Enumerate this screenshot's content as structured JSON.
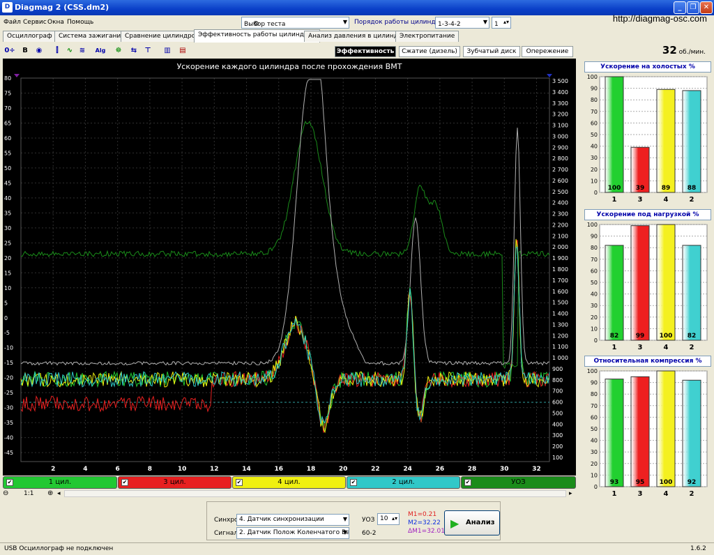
{
  "window": {
    "title": "Diagmag 2 (CSS.dm2)",
    "url": "http://diagmag-osc.com"
  },
  "menu": [
    "Файл",
    "Сервис",
    "Окна",
    "Помощь"
  ],
  "test_select": {
    "label": "Выбор теста"
  },
  "cyl_order": {
    "label": "Порядок работы цилиндров",
    "value": "1-3-4-2",
    "num": "1"
  },
  "tabs": [
    "Осциллограф",
    "Система зажигания",
    "Сравнение цилиндров",
    "Эффективность работы цилиндров",
    "Анализ давления в цилиндре",
    "Электропитание"
  ],
  "subtabs": [
    "Эффективность",
    "Сжатие (дизель)",
    "Зубчатый диск",
    "Опережение"
  ],
  "rpm": {
    "value": "32",
    "unit": "об./мин."
  },
  "chart": {
    "title": "Ускорение каждого цилиндра после прохождения ВМТ",
    "y_left": [
      "80",
      "75",
      "70",
      "65",
      "60",
      "55",
      "50",
      "45",
      "40",
      "35",
      "30",
      "25",
      "20",
      "15",
      "10",
      "5",
      "0",
      "-5",
      "-10",
      "-15",
      "-20",
      "-25",
      "-30",
      "-35",
      "-40",
      "-45"
    ],
    "y_right": [
      "3 500",
      "3 400",
      "3 300",
      "3 200",
      "3 100",
      "3 000",
      "2 900",
      "2 800",
      "2 700",
      "2 600",
      "2 500",
      "2 400",
      "2 300",
      "2 200",
      "2 100",
      "2 000",
      "1 900",
      "1 800",
      "1 700",
      "1 600",
      "1 500",
      "1 400",
      "1 300",
      "1 200",
      "1 100",
      "1 000",
      "900",
      "800",
      "700",
      "600",
      "500",
      "400",
      "300",
      "200",
      "100"
    ],
    "x_ticks": [
      "2",
      "4",
      "6",
      "8",
      "10",
      "12",
      "14",
      "16",
      "18",
      "20",
      "22",
      "24",
      "26",
      "28",
      "30",
      "32"
    ]
  },
  "channels": [
    {
      "label": "1 цил.",
      "color": "#22c832"
    },
    {
      "label": "3 цил.",
      "color": "#e82020"
    },
    {
      "label": "4 цил.",
      "color": "#f0f010"
    },
    {
      "label": "2 цил.",
      "color": "#30c8c8"
    },
    {
      "label": "УОЗ",
      "color": "#1a8c1a"
    }
  ],
  "zoom": "1:1",
  "sync": {
    "sync_label": "Синхро:",
    "sync_value": "4.  Датчик синхронизации",
    "signal_label": "Сигнал:",
    "signal_value": "2.  Датчик Полож Коленчатого Вал",
    "uoz_label": "УОЗ",
    "uoz_value": "10",
    "teeth": "60-2",
    "m1": "M1=0.21",
    "m2": "M2=32.22",
    "dm": "ΔM1=32.01",
    "analyze": "Анализ"
  },
  "status": {
    "left": "USB Осциллограф не подключен",
    "version": "1.6.2"
  },
  "bar_charts": [
    {
      "title": "Ускорение на холостых %",
      "values": [
        100,
        39,
        89,
        88
      ],
      "labels": [
        "1",
        "3",
        "4",
        "2"
      ]
    },
    {
      "title": "Ускорение под нагрузкой %",
      "values": [
        82,
        99,
        100,
        82
      ],
      "labels": [
        "1",
        "3",
        "4",
        "2"
      ]
    },
    {
      "title": "Относительная компрессия %",
      "values": [
        93,
        95,
        100,
        92
      ],
      "labels": [
        "1",
        "3",
        "4",
        "2"
      ]
    }
  ],
  "bar_axis": [
    "100",
    "90",
    "80",
    "70",
    "60",
    "50",
    "40",
    "30",
    "20",
    "10",
    "0"
  ],
  "bar_colors": [
    "#22d030",
    "#ee2020",
    "#f4f020",
    "#40d0d0"
  ]
}
